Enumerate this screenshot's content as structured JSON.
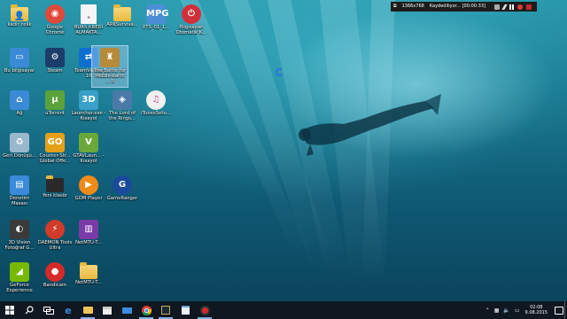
{
  "desktop_icons": [
    {
      "label": "kadir celik",
      "icon": "user-folder-icon",
      "color": "#f2c35a"
    },
    {
      "label": "Google Chrome",
      "icon": "chrome-icon",
      "color": "#de4a3a"
    },
    {
      "label": "BURS KREDİ ALMAKTA...",
      "icon": "document-icon",
      "color": "#f4f4f4"
    },
    {
      "label": "ARKSurviva...",
      "icon": "folder-icon",
      "color": "#f2c35a"
    },
    {
      "label": "VTS_01_1...",
      "icon": "mpg-video-icon",
      "color": "#4a8fd6"
    },
    {
      "label": "Bilgisayarı Otomatik K...",
      "icon": "power-icon",
      "color": "#d32f3a"
    },
    {
      "label": "Bu bilgisayar",
      "icon": "computer-icon",
      "color": "#3a8ad8"
    },
    {
      "label": "Steam",
      "icon": "steam-icon",
      "color": "#1b3d6a"
    },
    {
      "label": "TeamViewer 10",
      "icon": "teamviewer-icon",
      "color": "#0e6fd0"
    },
    {
      "label": "The Battle for Middle-earth ... II",
      "icon": "battle-middle-earth-icon",
      "color": "#b68a3a"
    },
    {
      "label": "Ağ",
      "icon": "network-icon",
      "color": "#3a8ad8"
    },
    {
      "label": "uTorrent",
      "icon": "utorrent-icon",
      "color": "#5aa33a"
    },
    {
      "label": "Launcher.exe - Kısayol",
      "icon": "3dm-launcher-icon",
      "color": "#3aa0c8"
    },
    {
      "label": "The Lord of the Rings...",
      "icon": "lotr-icon",
      "color": "#4a7aa8"
    },
    {
      "label": "iTunesSetu...",
      "icon": "itunes-icon",
      "color": "#f0f0f0"
    },
    {
      "label": "Geri Dönüşü...",
      "icon": "recycle-bin-icon",
      "color": "#9ab8cc"
    },
    {
      "label": "Counter-Str... Global Offe...",
      "icon": "csgo-icon",
      "color": "#e6a018"
    },
    {
      "label": "GTAVLaun... - Kısayol",
      "icon": "gta-v-icon",
      "color": "#6aa83a"
    },
    {
      "label": "Denetim Masası",
      "icon": "control-panel-icon",
      "color": "#3a8ad8"
    },
    {
      "label": "Yeni klasör",
      "icon": "folder-icon",
      "color": "#2a2a2a"
    },
    {
      "label": "GOM Player",
      "icon": "gom-player-icon",
      "color": "#f08a18"
    },
    {
      "label": "GameRanger",
      "icon": "gameranger-icon",
      "color": "#1a4a9a"
    },
    {
      "label": "3D Vision Fotoğraf G...",
      "icon": "3d-vision-icon",
      "color": "#3a3a3a"
    },
    {
      "label": "DAEMON Tools Ultra",
      "icon": "daemon-tools-icon",
      "color": "#d23a2a"
    },
    {
      "label": "NetMTU-T...",
      "icon": "winrar-icon",
      "color": "#7a3aa8"
    },
    {
      "label": "GeForce Experience",
      "icon": "geforce-icon",
      "color": "#76b900"
    },
    {
      "label": "Bandicam",
      "icon": "bandicam-icon",
      "color": "#d62a2a"
    },
    {
      "label": "NetMTU-T...",
      "icon": "folder-icon",
      "color": "#f2c35a"
    }
  ],
  "recorder_bar": {
    "resolution": "1366x768",
    "status": "Kaydediliyor... [00:00:33]"
  },
  "taskbar": {
    "items": [
      {
        "name": "start-button",
        "icon": "windows-logo-icon"
      },
      {
        "name": "search-button",
        "icon": "search-icon"
      },
      {
        "name": "task-view-button",
        "icon": "task-view-icon"
      },
      {
        "name": "edge-button",
        "icon": "edge-icon"
      },
      {
        "name": "file-explorer-button",
        "icon": "file-explorer-icon"
      },
      {
        "name": "store-button",
        "icon": "store-icon"
      },
      {
        "name": "mail-button",
        "icon": "mail-icon"
      },
      {
        "name": "chrome-button",
        "icon": "chrome-icon"
      },
      {
        "name": "lol-launcher-button",
        "icon": "league-icon"
      },
      {
        "name": "notepad-button",
        "icon": "notepad-icon"
      },
      {
        "name": "bandicam-button",
        "icon": "bandicam-icon"
      }
    ],
    "clock": {
      "time": "02:08",
      "date": "9.08.2015"
    }
  }
}
